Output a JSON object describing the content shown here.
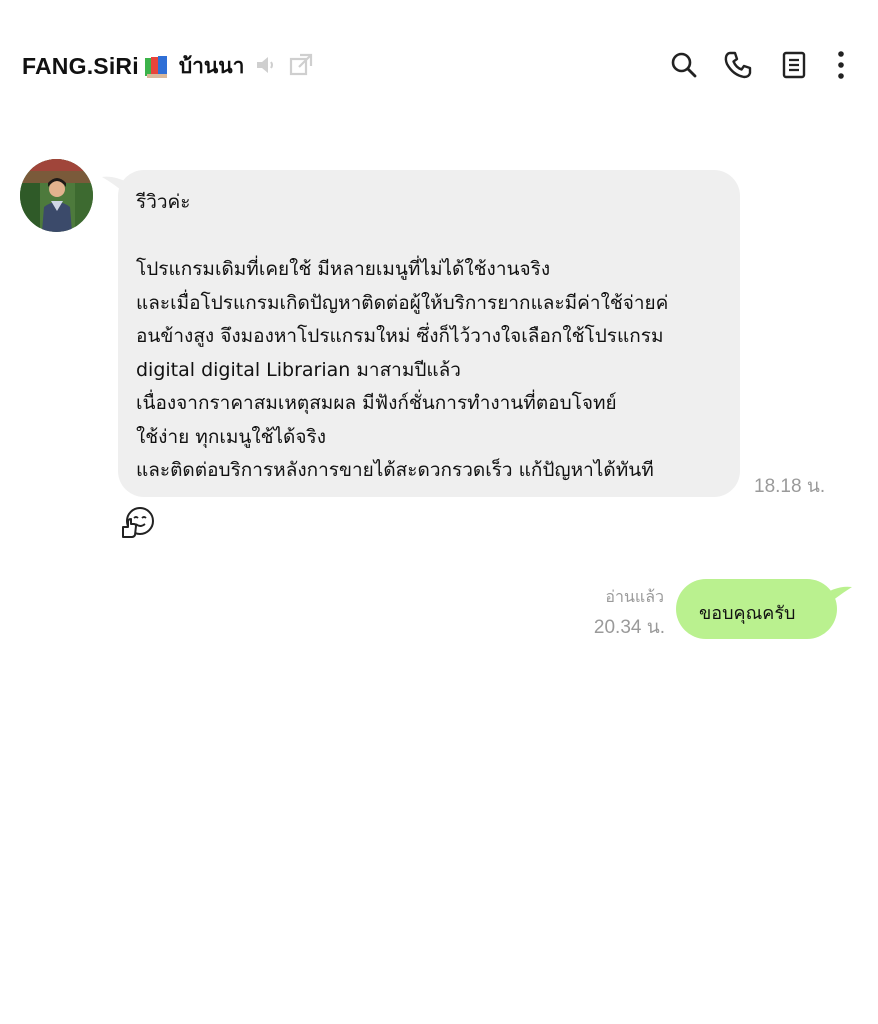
{
  "header": {
    "chat_name": "FANG.SiRi",
    "group_label": "บ้านนา",
    "icons": [
      "books-emoji-icon",
      "speaker-muted-icon",
      "popout-icon",
      "search-icon",
      "phone-icon",
      "notes-icon",
      "more-vertical-icon"
    ]
  },
  "messages": [
    {
      "direction": "incoming",
      "lines": [
        "รีวิวค่ะ",
        "",
        "โปรแกรมเดิมที่เคยใช้ มีหลายเมนูที่ไม่ได้ใช้งานจริง",
        "และเมื่อโปรแกรมเกิดปัญหาติดต่อผู้ให้บริการยากและมีค่าใช้จ่ายค่",
        "อนข้างสูง จึงมองหาโปรแกรมใหม่ ซึ่งก็ไว้วางใจเลือกใช้โปรแกรม",
        "digital digital Librarian มาสามปีแล้ว",
        "เนื่องจากราคาสมเหตุสมผล มีฟังก์ชั่นการทำงานที่ตอบโจทย์",
        "ใช้ง่าย ทุกเมนูใช้ได้จริง",
        "และติดต่อบริการหลังการขายได้สะดวกรวดเร็ว แก้ปัญหาได้ทันที"
      ],
      "time": "18.18 น.",
      "reaction": "thumbs-up-face-icon"
    },
    {
      "direction": "outgoing",
      "text": "ขอบคุณครับ",
      "read_label": "อ่านแล้ว",
      "time": "20.34 น."
    }
  ],
  "colors": {
    "incoming_bubble": "#efefef",
    "outgoing_bubble": "#baf18f",
    "meta_text": "#9a9a9a"
  }
}
